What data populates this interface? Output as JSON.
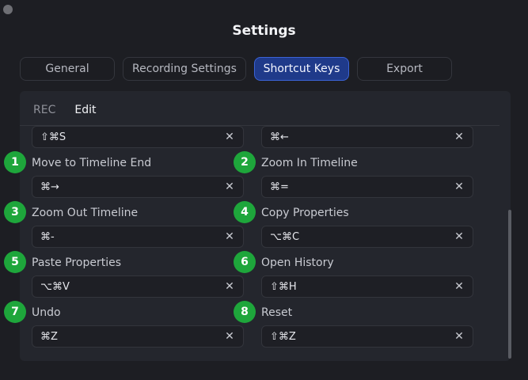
{
  "window": {
    "title": "Settings"
  },
  "tabs": [
    {
      "label": "General",
      "active": false
    },
    {
      "label": "Recording Settings",
      "active": false
    },
    {
      "label": "Shortcut Keys",
      "active": true
    },
    {
      "label": "Export",
      "active": false
    }
  ],
  "subtabs": [
    {
      "label": "REC",
      "active": false
    },
    {
      "label": "Edit",
      "active": true
    }
  ],
  "shortcuts": {
    "top_left": {
      "keys": "⇧⌘S"
    },
    "top_right": {
      "keys": "⌘←"
    },
    "items": [
      {
        "badge": "1",
        "label": "Move to Timeline End",
        "keys": "⌘→"
      },
      {
        "badge": "2",
        "label": "Zoom In Timeline",
        "keys": "⌘="
      },
      {
        "badge": "3",
        "label": "Zoom Out Timeline",
        "keys": "⌘-"
      },
      {
        "badge": "4",
        "label": "Copy Properties",
        "keys": "⌥⌘C"
      },
      {
        "badge": "5",
        "label": "Paste Properties",
        "keys": "⌥⌘V"
      },
      {
        "badge": "6",
        "label": "Open History",
        "keys": "⇧⌘H"
      },
      {
        "badge": "7",
        "label": "Undo",
        "keys": "⌘Z"
      },
      {
        "badge": "8",
        "label": "Reset",
        "keys": "⇧⌘Z"
      }
    ]
  },
  "icons": {
    "clear": "close-icon",
    "clear_glyph": "✕"
  },
  "colors": {
    "accent": "#1f3a8a",
    "badge": "#1ea63b",
    "background": "#1d1e23"
  }
}
